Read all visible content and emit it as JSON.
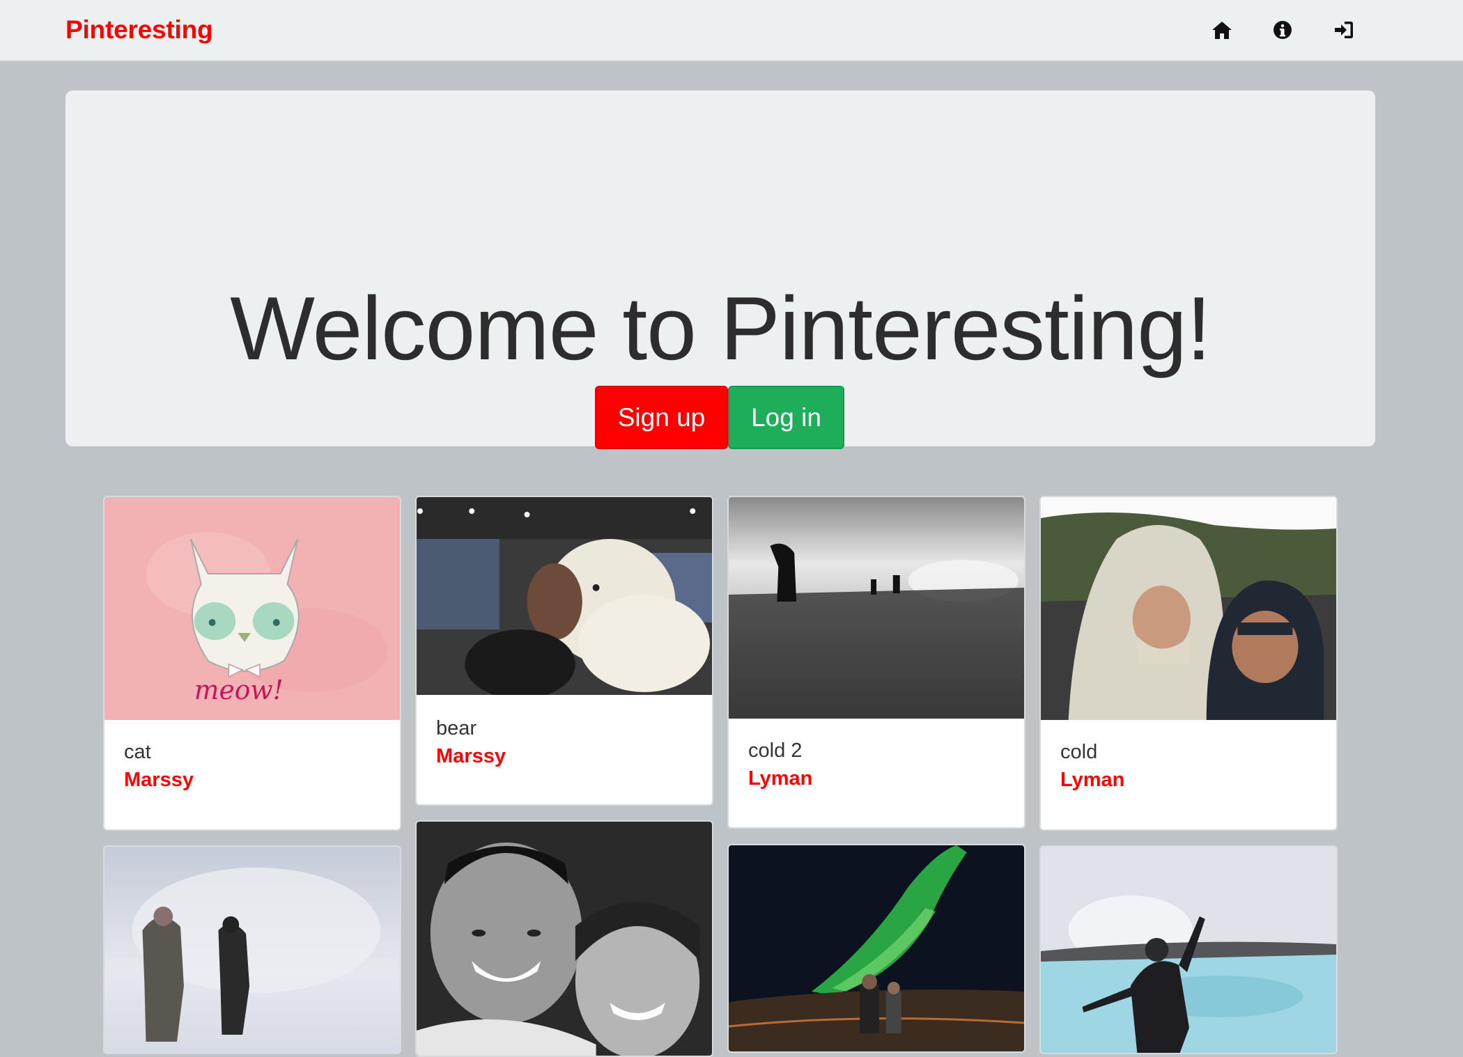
{
  "navbar": {
    "brand": "Pinteresting",
    "icons": [
      "home-icon",
      "info-icon",
      "sign-in-icon"
    ]
  },
  "jumbotron": {
    "title": "Welcome to Pinteresting!",
    "signup_label": "Sign up",
    "login_label": "Log in"
  },
  "colors": {
    "brand_red": "#ff0000",
    "login_green": "#1ead59",
    "page_bg": "#bdc3c7",
    "panel_bg": "#ecf0f1"
  },
  "pins": [
    {
      "title": "cat",
      "user": "Marssy"
    },
    {
      "title": "bear",
      "user": "Marssy"
    },
    {
      "title": "cold 2",
      "user": "Lyman"
    },
    {
      "title": "cold",
      "user": "Lyman"
    },
    {
      "title": "",
      "user": ""
    },
    {
      "title": "",
      "user": ""
    },
    {
      "title": "",
      "user": ""
    },
    {
      "title": "",
      "user": ""
    }
  ]
}
